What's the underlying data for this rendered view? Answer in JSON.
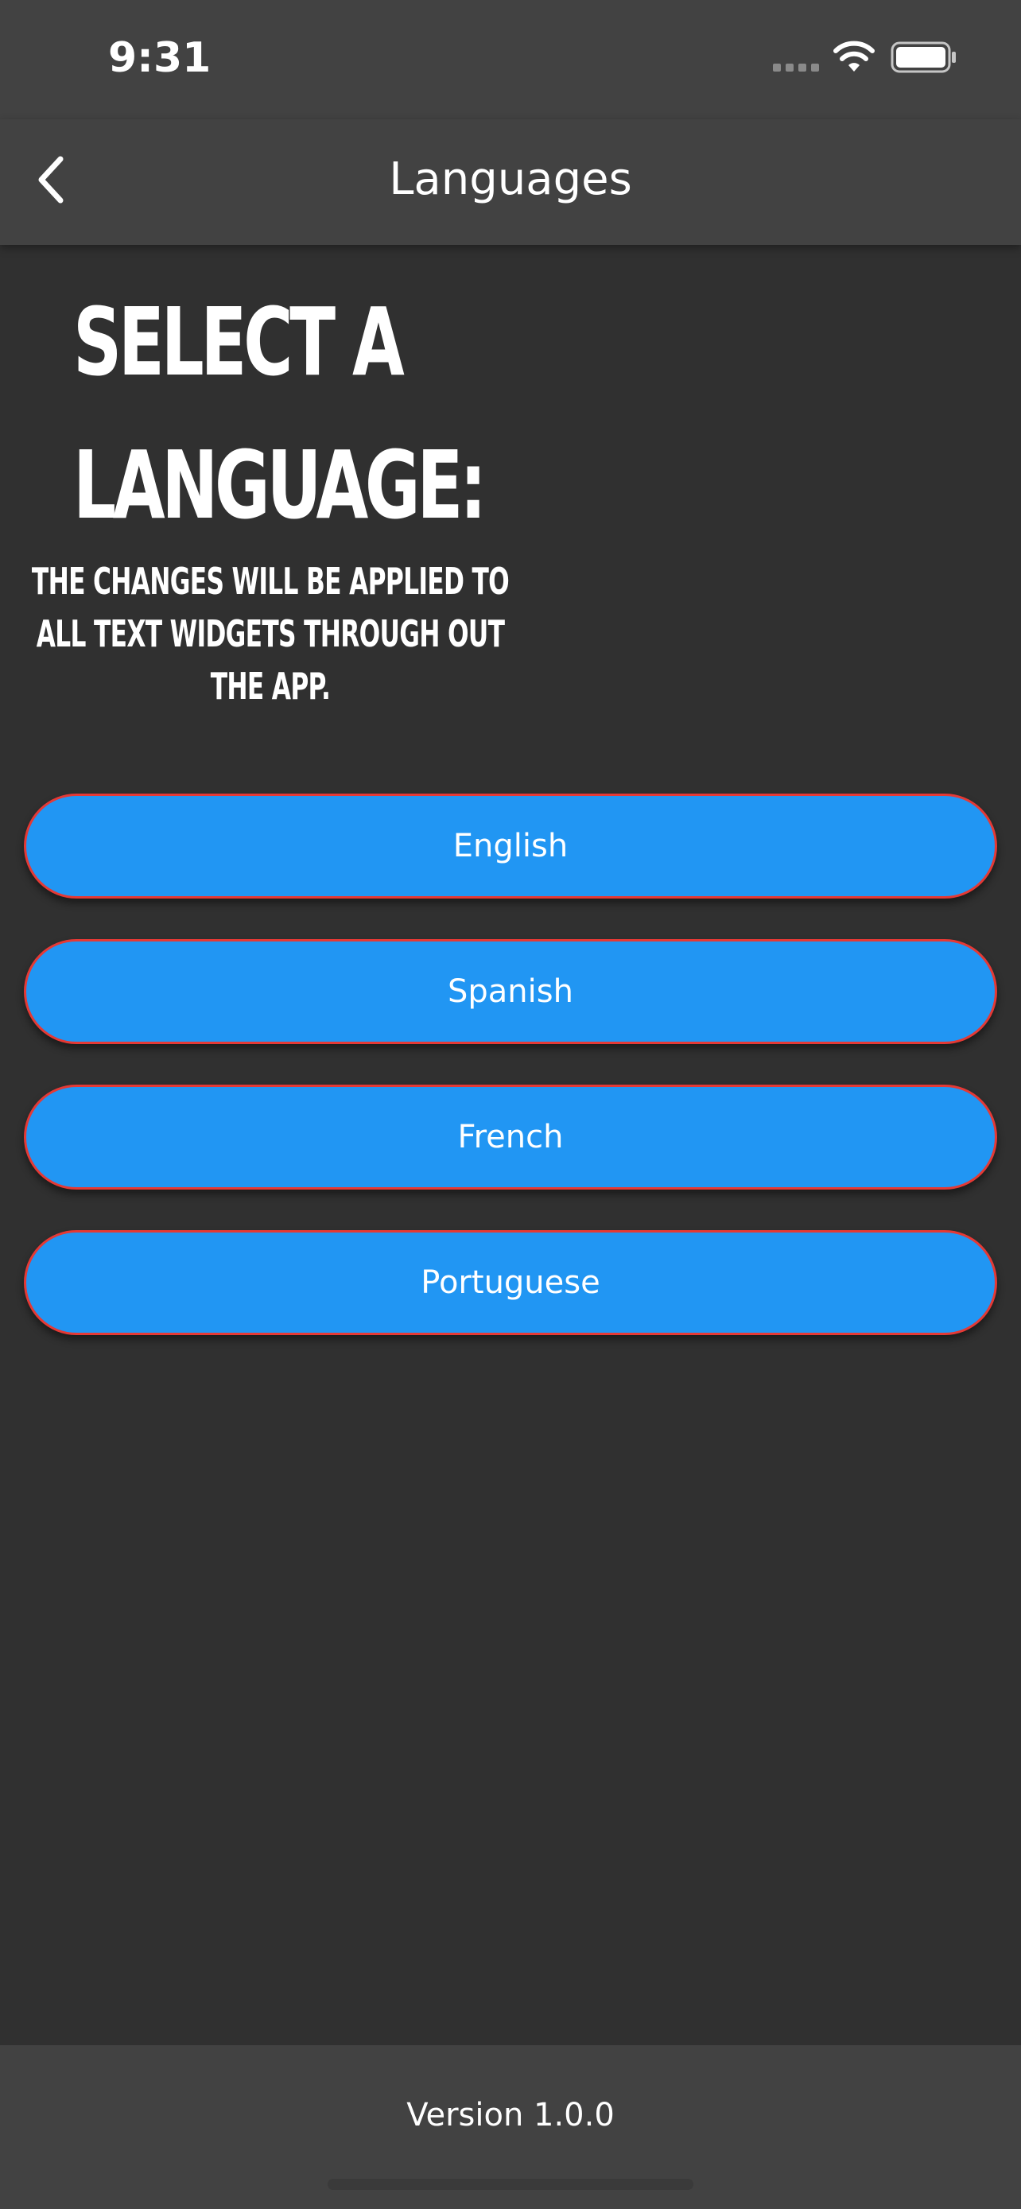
{
  "status_bar": {
    "time": "9:31"
  },
  "app_bar": {
    "title": "Languages",
    "back_icon": "chevron-left-icon"
  },
  "heading": {
    "title": "Select a language:",
    "subtitle": "The changes will be applied to all text widgets through out the app."
  },
  "languages": [
    {
      "label": "English"
    },
    {
      "label": "Spanish"
    },
    {
      "label": "French"
    },
    {
      "label": "Portuguese"
    }
  ],
  "footer": {
    "version": "Version 1.0.0"
  },
  "colors": {
    "background": "#303030",
    "app_bar": "#424242",
    "button_fill": "#2196f3",
    "button_border": "#e53935",
    "text": "#ffffff"
  }
}
